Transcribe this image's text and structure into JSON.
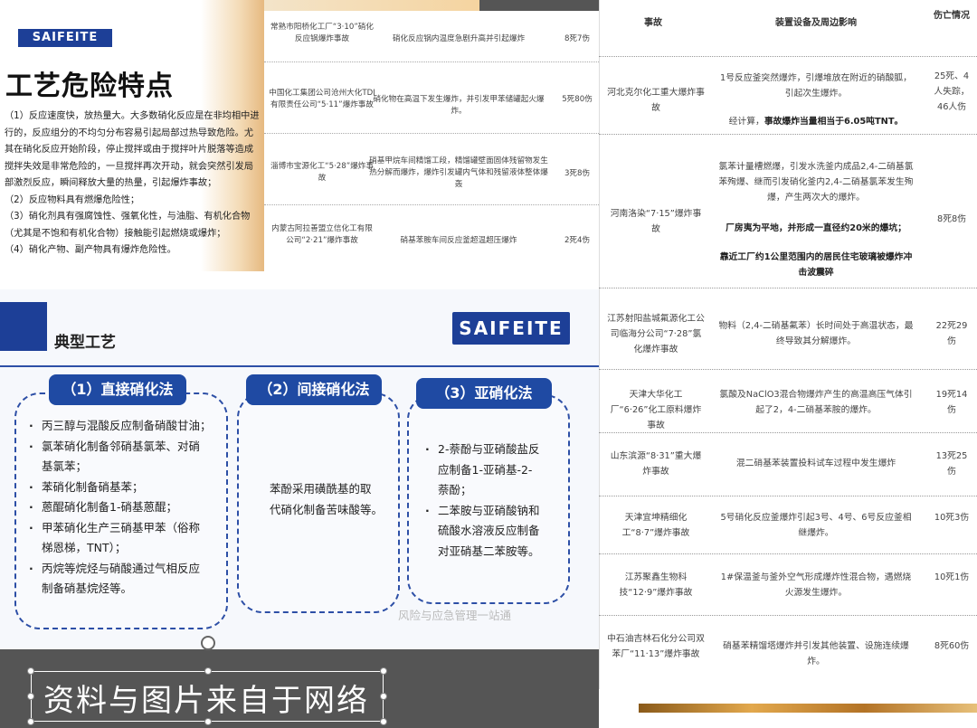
{
  "slide_a": {
    "logo": "SAIFEITE",
    "title": "工艺危险特点",
    "paragraphs": [
      "（1）反应速度快，放热量大。大多数硝化反应是在非均相中进行的，反应组分的不均匀分布容易引起局部过热导致危险。尤其在硝化反应开始阶段，停止搅拌或由于搅拌叶片脱落等造成搅拌失效是非常危险的，一旦搅拌再次开动，就会突然引发局部激烈反应，瞬间释放大量的热量，引起爆炸事故；",
      "（2）反应物料具有燃爆危险性；",
      "（3）硝化剂具有强腐蚀性、强氧化性，与油脂、有机化合物（尤其是不饱和有机化合物）接触能引起燃烧或爆炸；",
      "（4）硝化产物、副产物具有爆炸危险性。"
    ]
  },
  "mid_table": {
    "rows": [
      {
        "name": "常熟市阳桥化工厂“3·10”硝化反应锅爆炸事故",
        "cause": "硝化反应锅内温度急剧升高并引起爆炸",
        "casualty": "8死7伤"
      },
      {
        "name": "中国化工集团公司沧州大化TDI有限责任公司“5·11”爆炸事故",
        "cause": "硝化物在高温下发生爆炸，并引发甲苯储罐起火爆炸。",
        "casualty": "5死80伤"
      },
      {
        "name": "淄博市宝源化工“5·28”爆炸事故",
        "cause": "硝基甲烷车间精馏工段，精馏罐壁面固体残留物发生热分解而爆炸，爆炸引发罐内气体和残留液体整体爆轰",
        "casualty": "3死8伤"
      },
      {
        "name": "内蒙古阿拉善盟立信化工有限公司“2·21”爆炸事故",
        "cause": "硝基苯胺车间反应釜超温超压爆炸",
        "casualty": "2死4伤"
      }
    ]
  },
  "right_table": {
    "headers": {
      "accident": "事故",
      "impact": "装置设备及周边影响",
      "casualty": "伤亡情况"
    },
    "rows": [
      {
        "name": "河北克尔化工重大爆炸事故",
        "impact_lines": [
          "1号反应釜突然爆炸，引爆堆放在附近的硝酸胍，引起次生爆炸。",
          "经计算，",
          "事故爆炸当量相当于6.05吨TNT。"
        ],
        "casualty": "25死、4人失踪，46人伤"
      },
      {
        "name": "河南洛染“7·15”爆炸事故",
        "impact_lines": [
          "氯苯计量槽燃爆，引发水洗釜内成品2,4-二硝基氯苯殉爆、继而引发硝化釜内2,4-二硝基氯苯发生殉爆，产生两次大的爆炸。",
          "厂房夷为平地，并形成一直径约20米的爆坑；",
          "靠近工厂约1公里范围内的居民住宅玻璃被爆炸冲击波震碎"
        ],
        "casualty": "8死8伤"
      },
      {
        "name": "江苏射阳盐城氟源化工公司临海分公司“7·28”氯化爆炸事故",
        "impact": "物料（2,4-二硝基氟苯）长时间处于高温状态，最终导致其分解爆炸。",
        "casualty": "22死29伤"
      },
      {
        "name": "天津大华化工厂“6·26”化工原料爆炸事故",
        "impact": "氯酸及NaClO3混合物爆炸产生的高温高压气体引起了2，4-二硝基苯胺的爆炸。",
        "casualty": "19死14伤"
      },
      {
        "name": "山东滨源“8·31”重大爆炸事故",
        "impact": "混二硝基苯装置投料试车过程中发生爆炸",
        "casualty": "13死25伤"
      },
      {
        "name": "天津宜坤精细化工“8·7”爆炸事故",
        "impact": "5号硝化反应釜爆炸引起3号、4号、6号反应釜相继爆炸。",
        "casualty": "10死3伤"
      },
      {
        "name": "江苏聚鑫生物科技“12·9”爆炸事故",
        "impact": "1#保温釜与釜外空气形成爆炸性混合物，遇燃烧火源发生爆炸。",
        "casualty": "10死1伤"
      },
      {
        "name": "中石油吉林石化分公司双苯厂“11·13”爆炸事故",
        "impact": "硝基苯精馏塔爆炸并引发其他装置、设施连续爆炸。",
        "casualty": "8死60伤"
      }
    ]
  },
  "slide_b": {
    "headline": "典型工艺",
    "logo": "SAIFEITE",
    "boxes": [
      {
        "title": "（1）直接硝化法",
        "items": [
          "丙三醇与混酸反应制备硝酸甘油；",
          "氯苯硝化制备邻硝基氯苯、对硝|基氯苯；",
          "苯硝化制备硝基苯；",
          "蒽醌硝化制备1-硝基蒽醌；",
          "甲苯硝化生产三硝基甲苯（俗称|梯恩梯，TNT）；",
          "丙烷等烷烃与硝酸通过气相反应|制备硝基烷烃等。"
        ]
      },
      {
        "title": "（2）间接硝化法",
        "items": [
          "苯酚采用磺酰基的取|代硝化制备苦味酸等。"
        ]
      },
      {
        "title": "（3）亚硝化法",
        "items": [
          "2-萘酚与亚硝酸盐反|应制备1-亚硝基-2-|萘酚；",
          "二苯胺与亚硝酸钠和|硫酸水溶液反应制备|对亚硝基二苯胺等。"
        ]
      }
    ],
    "watermark": "风险与应急管理一站通"
  },
  "caption": {
    "text": "资料与图片来自于网络"
  }
}
